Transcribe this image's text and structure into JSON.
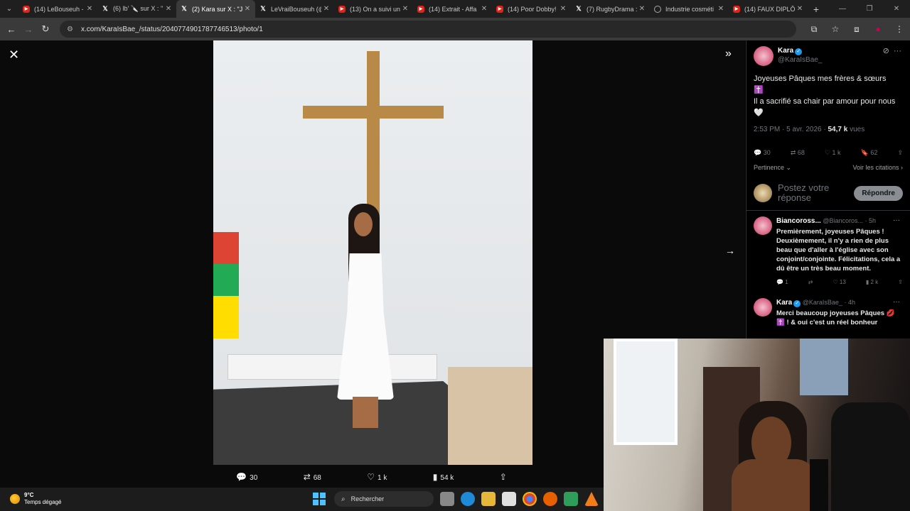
{
  "browser": {
    "tabs": [
      {
        "title": "(14) LeBouseuh -",
        "icon": "youtube-icon"
      },
      {
        "title": "(6) lb' 🔪 sur X : \"",
        "icon": "x-icon"
      },
      {
        "title": "(2) Kara sur X : \"J",
        "icon": "x-icon",
        "active": true
      },
      {
        "title": "LeVraiBouseuh (@",
        "icon": "x-icon"
      },
      {
        "title": "(13) On a suivi un",
        "icon": "youtube-icon"
      },
      {
        "title": "(14) Extrait - Affa",
        "icon": "youtube-icon"
      },
      {
        "title": "(14) Poor Dobby!",
        "icon": "youtube-icon"
      },
      {
        "title": "(7) RugbyDrama :",
        "icon": "x-icon"
      },
      {
        "title": "Industrie cosméti",
        "icon": "globe-icon"
      },
      {
        "title": "(14) FAUX DIPLÔ",
        "icon": "youtube-icon"
      }
    ],
    "url": "x.com/KaraIsBae_/status/2040774901787746513/photo/1"
  },
  "photo_actions": {
    "replies": "30",
    "reposts": "68",
    "likes": "1 k",
    "views": "54 k"
  },
  "post": {
    "author_name": "Kara",
    "author_handle": "@KaraIsBae_",
    "text_line1": "Joyeuses Pâques mes frères & sœurs",
    "text_emoji": "✝️",
    "text_line2": "Il a sacrifié sa chair par amour pour nous 🤍",
    "time": "2:53 PM · 5 avr. 2026 ·",
    "views_count": "54,7 k",
    "views_label": "vues",
    "stats": {
      "replies": "30",
      "reposts": "68",
      "likes": "1 k",
      "bookmarks": "62"
    },
    "sort_label": "Pertinence",
    "quotes_label": "Voir les citations"
  },
  "reply_box": {
    "placeholder": "Postez votre réponse",
    "button": "Répondre"
  },
  "comments": [
    {
      "name": "Biancoross...",
      "handle": "@Biancoros...",
      "time": "· 5h",
      "text": "Premièrement, joyeuses Pâques ! Deuxièmement, il n'y a rien de plus beau que d'aller à l'église avec son conjoint/conjointe. Félicitations, cela a dû être un très beau moment.",
      "stats": {
        "replies": "1",
        "reposts": "",
        "likes": "13",
        "views": "2 k"
      }
    },
    {
      "name": "Kara",
      "handle": "@KaraIsBae_",
      "time": "· 4h",
      "text": "Merci beaucoup joyeuses Pâques 💋✝️ ! & oui c'est un réel bonheur",
      "stats": {
        "replies": "",
        "reposts": "",
        "likes": "",
        "views": ""
      }
    }
  ],
  "taskbar": {
    "temperature": "9°C",
    "weather": "Temps dégagé",
    "search_label": "Rechercher"
  }
}
